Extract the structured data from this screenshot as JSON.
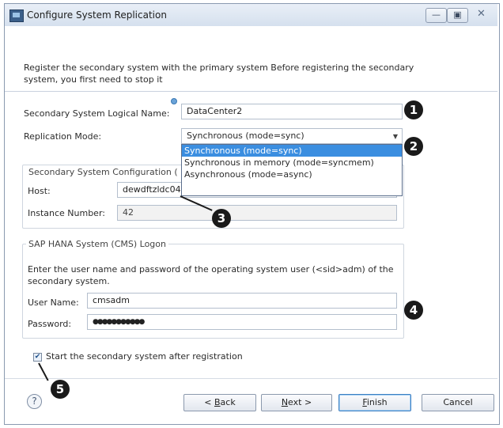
{
  "window": {
    "title": "Configure System Replication",
    "min_glyph": "—",
    "max_glyph": "▣",
    "close_glyph": "✕"
  },
  "description": "Register the secondary system with the primary system Before registering the secondary system, you first need to stop it",
  "form": {
    "logical_name_label": "Secondary System Logical Name:",
    "logical_name_value": "DataCenter2",
    "replication_mode_label": "Replication Mode:",
    "replication_mode_value": "Synchronous (mode=sync)",
    "replication_options": [
      "Synchronous (mode=sync)",
      "Synchronous in memory (mode=syncmem)",
      "Asynchronous (mode=async)"
    ]
  },
  "secondary_config": {
    "group_label": "Secondary System Configuration (",
    "host_label": "Host:",
    "host_value": "dewdftzldc04",
    "instance_label": "Instance Number:",
    "instance_value": "42"
  },
  "logon": {
    "group_label": "SAP HANA System (CMS) Logon",
    "instructions": "Enter the user name and password of the operating system user (<sid>adm) of the secondary system.",
    "user_label": "User Name:",
    "user_value": "cmsadm",
    "password_label": "Password:",
    "password_value": "●●●●●●●●●●●"
  },
  "start_after_registration": {
    "label": "Start the secondary system after registration",
    "checked": true,
    "check_glyph": "✔"
  },
  "footer": {
    "help": "?",
    "back_underline": "B",
    "back_rest": "ack",
    "back_prefix": "< ",
    "next_underline": "N",
    "next_rest": "ext >",
    "finish_underline": "F",
    "finish_rest": "inish",
    "cancel": "Cancel"
  },
  "callouts": [
    "1",
    "2",
    "3",
    "4",
    "5"
  ],
  "colors": {
    "selection": "#3b8ee0",
    "callout": "#1a1a1a",
    "title_bar": "#dfe7f2"
  }
}
